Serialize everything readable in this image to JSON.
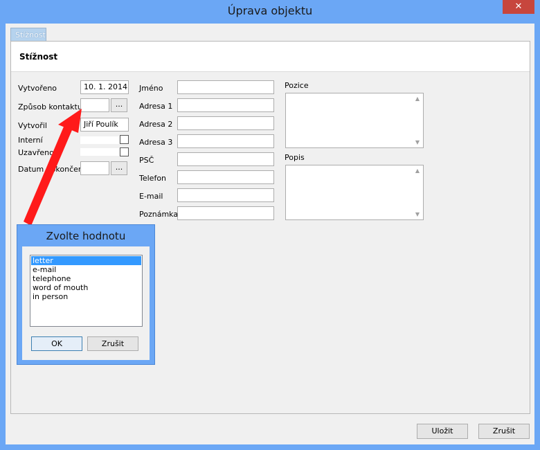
{
  "window": {
    "title": "Úprava objektu",
    "close_glyph": "✕"
  },
  "tabs": [
    {
      "label": "Stížnost"
    }
  ],
  "panel": {
    "title": "Stížnost"
  },
  "left_form": {
    "vytvoreno_label": "Vytvořeno",
    "vytvoreno_value": "10. 1. 2014",
    "zpusob_label": "Způsob kontaktu",
    "zpusob_value": "",
    "vytvoril_label": "Vytvořil",
    "vytvoril_value": "Jiří Poulík",
    "interni_label": "Interní",
    "uzavreno_label": "Uzavřeno",
    "datum_label": "Datum dokončení",
    "datum_value": "",
    "browse_glyph": "..."
  },
  "middle_form": {
    "jmeno_label": "Jméno",
    "adresa1_label": "Adresa 1",
    "adresa2_label": "Adresa 2",
    "adresa3_label": "Adresa 3",
    "psc_label": "PSČ",
    "telefon_label": "Telefon",
    "email_label": "E-mail",
    "poznamka_label": "Poznámka"
  },
  "right_form": {
    "pozice_label": "Pozice",
    "popis_label": "Popis",
    "scroll_up_glyph": "▲",
    "scroll_down_glyph": "▼"
  },
  "footer": {
    "save_label": "Uložit",
    "cancel_label": "Zrušit"
  },
  "dialog": {
    "title": "Zvolte hodnotu",
    "options": [
      "letter",
      "e-mail",
      "telephone",
      "word of mouth",
      "in person"
    ],
    "selected_index": 0,
    "ok_label": "OK",
    "cancel_label": "Zrušit"
  },
  "colors": {
    "window_frame": "#6ba7f5",
    "close_button": "#c7463d",
    "selection": "#3399ff",
    "annotation_arrow": "#ff1a1a"
  },
  "icons": {
    "close": "close-icon",
    "scroll_up": "scroll-up-icon",
    "scroll_down": "scroll-down-icon",
    "arrow": "annotation-arrow"
  }
}
